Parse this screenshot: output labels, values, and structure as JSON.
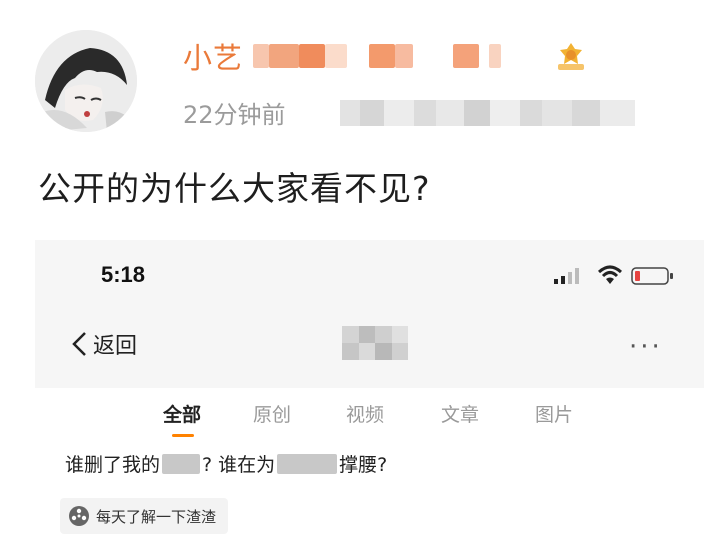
{
  "post": {
    "username": "小艺",
    "time_ago": "22分钟前",
    "text": "公开的为什么大家看不见?"
  },
  "screenshot": {
    "status_time": "5:18",
    "nav": {
      "back_label": "返回",
      "more_label": "···"
    },
    "tabs": [
      "全部",
      "原创",
      "视频",
      "文章",
      "图片"
    ],
    "active_tab": "全部",
    "headline": {
      "part1": "谁删了我的",
      "part2": "? 谁在为",
      "part3": "撑腰?"
    },
    "topic_chip": "每天了解一下渣渣"
  },
  "colors": {
    "username": "#ea7a3a",
    "tab_underline": "#ff8200",
    "battery_low": "#e64340"
  },
  "icons": [
    "avatar",
    "badge-icon",
    "signal-icon",
    "wifi-icon",
    "battery-icon",
    "back-chevron-icon",
    "more-icon",
    "topic-icon"
  ]
}
